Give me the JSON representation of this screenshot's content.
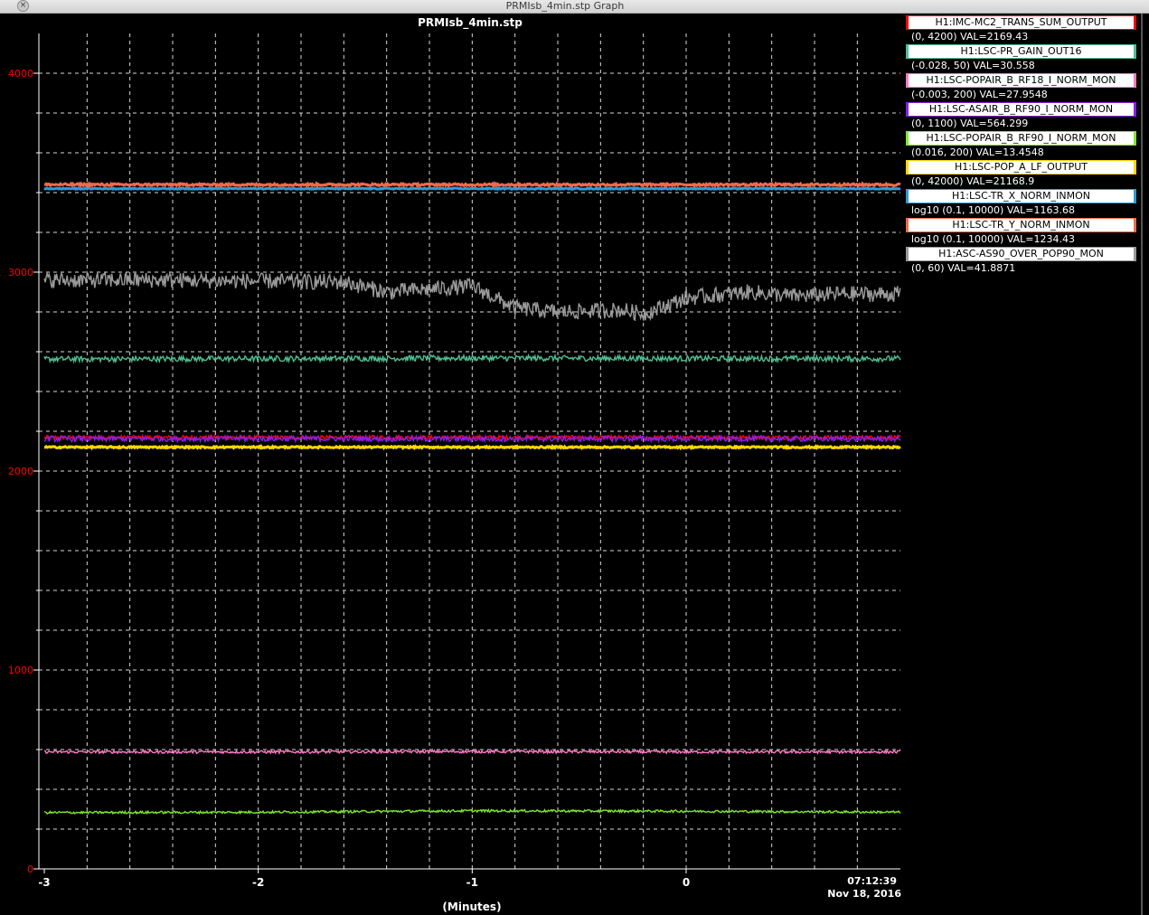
{
  "window": {
    "title": "PRMIsb_4min.stp Graph",
    "close_icon": "×"
  },
  "plot": {
    "title": "PRMIsb_4min.stp",
    "x_axis_label": "(Minutes)",
    "time_stamp": "07:12:39",
    "date_stamp": "Nov 18, 2016"
  },
  "chart_data": {
    "type": "line",
    "title": "PRMIsb_4min.stp",
    "xlabel": "(Minutes)",
    "ylabel": "",
    "xlim": [
      -3,
      1
    ],
    "ylim": [
      0,
      4200
    ],
    "x_ticks": [
      -3,
      -2,
      -1,
      0
    ],
    "x_tick_labels": [
      "-3",
      "-2",
      "-1",
      "0"
    ],
    "y_ticks": [
      0,
      1000,
      2000,
      3000,
      4000
    ],
    "y_tick_labels": [
      "0",
      "1000",
      "2000",
      "3000",
      "4000"
    ],
    "y_axis_color": "#ff0000",
    "grid": true,
    "legend_position": "right",
    "background": "#000000",
    "series": [
      {
        "name": "H1:IMC-MC2_TRANS_SUM_OUTPUT",
        "range": "(0, 4200) VAL=2169.43",
        "color": "#ff0000",
        "level": 2169,
        "noise": 10,
        "x": [
          -3,
          -2,
          -1,
          0,
          1
        ],
        "y": [
          2169,
          2169,
          2169,
          2169,
          2169
        ]
      },
      {
        "name": "H1:LSC-PR_GAIN_OUT16",
        "range": "(-0.028, 50) VAL=30.558",
        "color": "#4dbf94",
        "level": 2565,
        "noise": 14,
        "x": [
          -3,
          -2,
          -1,
          0,
          1
        ],
        "y": [
          2563,
          2565,
          2568,
          2566,
          2565
        ]
      },
      {
        "name": "H1:LSC-POPAIR_B_RF18_I_NORM_MON",
        "range": "(-0.003, 200) VAL=27.9548",
        "color": "#ff77c6",
        "level": 588,
        "noise": 7,
        "x": [
          -3,
          -2,
          -1,
          0,
          1
        ],
        "y": [
          588,
          588,
          590,
          588,
          588
        ]
      },
      {
        "name": "H1:LSC-ASAIR_B_RF90_I_NORM_MON",
        "range": "(0, 1100) VAL=564.299",
        "color": "#8a1fe6",
        "level": 2162,
        "noise": 14,
        "x": [
          -3,
          -2,
          -1,
          0,
          1
        ],
        "y": [
          2162,
          2163,
          2162,
          2163,
          2162
        ]
      },
      {
        "name": "H1:LSC-POPAIR_B_RF90_I_NORM_MON",
        "range": "(0.016, 200) VAL=13.4548",
        "color": "#7ee82a",
        "level": 285,
        "noise": 6,
        "x": [
          -3,
          -2,
          -1,
          0,
          1
        ],
        "y": [
          283,
          285,
          292,
          290,
          285
        ]
      },
      {
        "name": "H1:LSC-POP_A_LF_OUTPUT",
        "range": "(0, 42000) VAL=21168.9",
        "color": "#ffd700",
        "level": 2120,
        "noise": 4,
        "x": [
          -3,
          -2,
          -1,
          0,
          1
        ],
        "y": [
          2120,
          2120,
          2120,
          2120,
          2120
        ]
      },
      {
        "name": "H1:LSC-TR_X_NORM_INMON",
        "range": "log10 (0.1, 10000) VAL=1163.68",
        "color": "#2f9bd6",
        "level": 3420,
        "noise": 3,
        "x": [
          -3,
          -2,
          -1,
          0,
          1
        ],
        "y": [
          3420,
          3420,
          3420,
          3420,
          3420
        ]
      },
      {
        "name": "H1:LSC-TR_Y_NORM_INMON",
        "range": "log10 (0.1, 10000) VAL=1234.43",
        "color": "#f06a4c",
        "level": 3440,
        "noise": 5,
        "x": [
          -3,
          -2,
          -1,
          0,
          1
        ],
        "y": [
          3440,
          3440,
          3440,
          3440,
          3440
        ]
      },
      {
        "name": "H1:ASC-AS90_OVER_POP90_MON",
        "range": "(0, 60) VAL=41.8871",
        "color": "#9a9a9a",
        "level": 2950,
        "noise": 40,
        "x": [
          -3,
          -2.5,
          -2,
          -1.6,
          -1.4,
          -1.0,
          -0.8,
          -0.6,
          -0.3,
          -0.2,
          0,
          0.3,
          0.5,
          0.7,
          1.0
        ],
        "y": [
          2960,
          2960,
          2955,
          2950,
          2900,
          2930,
          2820,
          2800,
          2810,
          2790,
          2870,
          2900,
          2880,
          2890,
          2890
        ]
      }
    ]
  }
}
